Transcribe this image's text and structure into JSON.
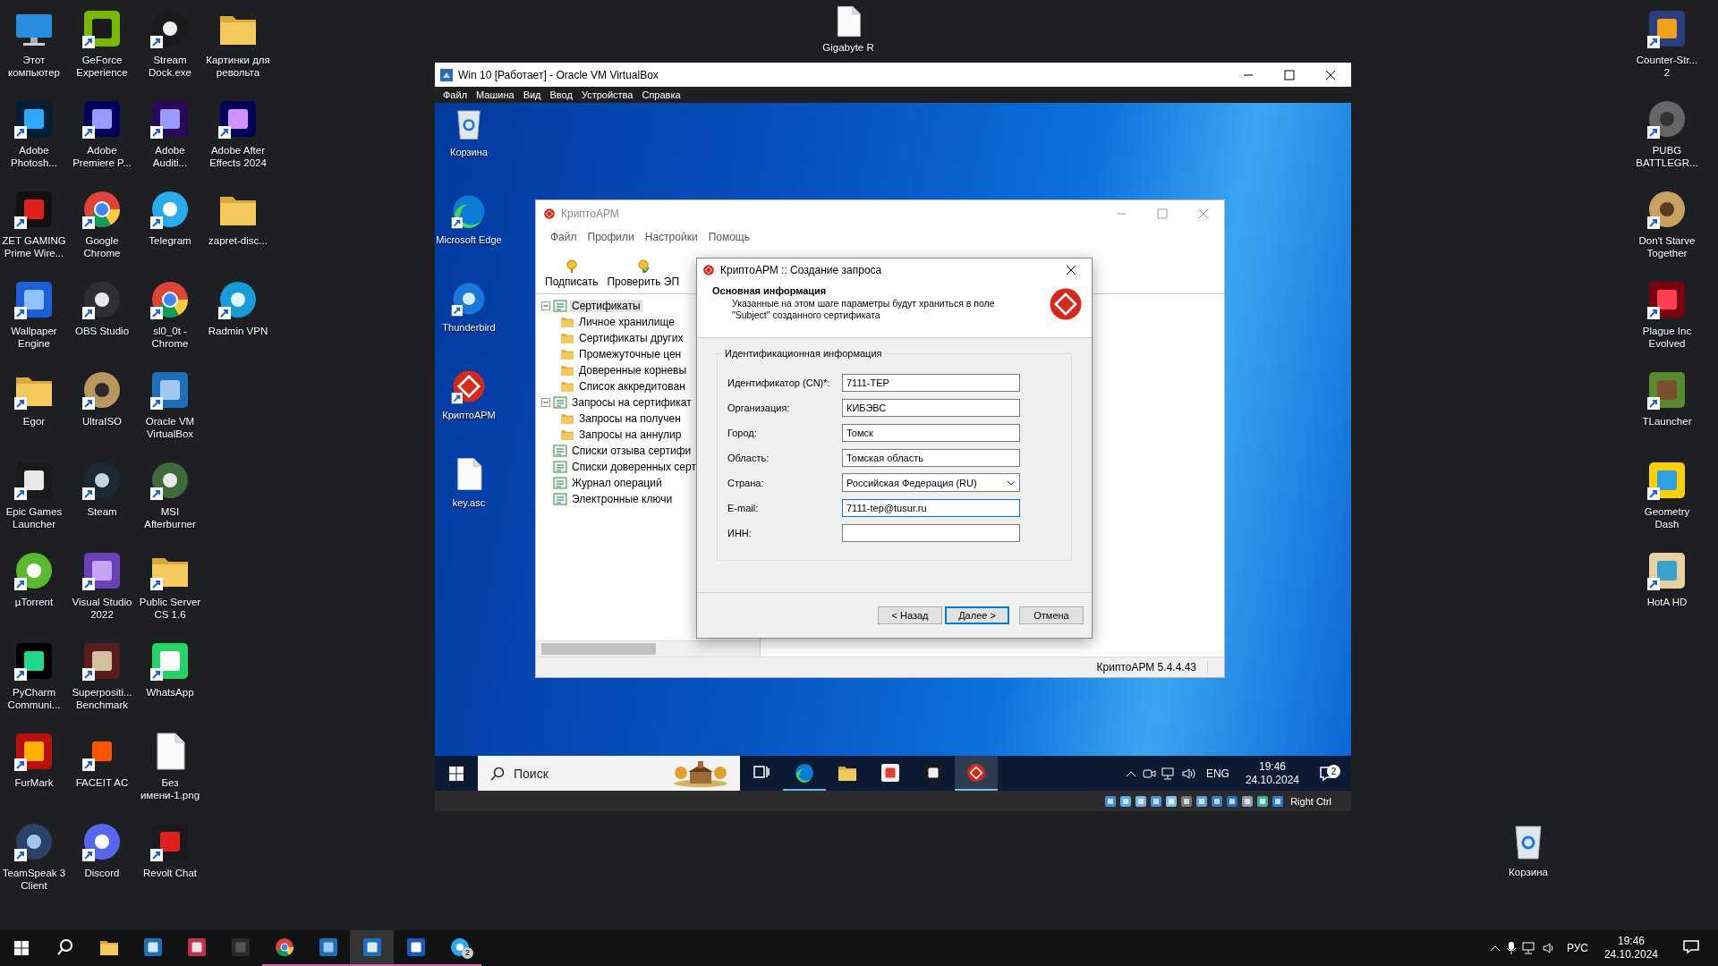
{
  "desktop": {
    "left_icons": [
      {
        "label": "Этот компьютер",
        "shortcut": false
      },
      {
        "label": "Adobe Photosh...",
        "shortcut": true
      },
      {
        "label": "ZET GAMING Prime Wire...",
        "shortcut": true
      },
      {
        "label": "Wallpaper Engine",
        "shortcut": true
      },
      {
        "label": "Egor",
        "shortcut": true
      },
      {
        "label": "Epic Games Launcher",
        "shortcut": true
      },
      {
        "label": "µTorrent",
        "shortcut": true
      },
      {
        "label": "PyCharm Communi...",
        "shortcut": true
      },
      {
        "label": "FurMark",
        "shortcut": true
      },
      {
        "label": "TeamSpeak 3 Client",
        "shortcut": true
      },
      {
        "label": "GeForce Experience",
        "shortcut": true
      },
      {
        "label": "Adobe Premiere P...",
        "shortcut": true
      },
      {
        "label": "Google Chrome",
        "shortcut": true
      },
      {
        "label": "OBS Studio",
        "shortcut": true
      },
      {
        "label": "UltraISO",
        "shortcut": true
      },
      {
        "label": "Steam",
        "shortcut": true
      },
      {
        "label": "Visual Studio 2022",
        "shortcut": true
      },
      {
        "label": "Superpositi... Benchmark",
        "shortcut": true
      },
      {
        "label": "FACEIT AC",
        "shortcut": true
      },
      {
        "label": "Discord",
        "shortcut": true
      },
      {
        "label": "Stream Dock.exe",
        "shortcut": true
      },
      {
        "label": "Adobe Auditi...",
        "shortcut": true
      },
      {
        "label": "Telegram",
        "shortcut": true
      },
      {
        "label": "sl0_0t - Chrome",
        "shortcut": true
      },
      {
        "label": "Oracle VM VirtualBox",
        "shortcut": true
      },
      {
        "label": "MSI Afterburner",
        "shortcut": true
      },
      {
        "label": "Public Server CS 1.6",
        "shortcut": true
      },
      {
        "label": "WhatsApp",
        "shortcut": true
      },
      {
        "label": "Без имени-1.png",
        "shortcut": false
      },
      {
        "label": "Revolt Chat",
        "shortcut": true
      },
      {
        "label": "Картинки для револьта",
        "shortcut": false
      },
      {
        "label": "Adobe After Effects 2024",
        "shortcut": true
      },
      {
        "label": "zapret-disc...",
        "shortcut": false
      },
      {
        "label": "Radmin VPN",
        "shortcut": true
      }
    ],
    "right_icons": [
      {
        "label": "Counter-Str... 2",
        "shortcut": true
      },
      {
        "label": "PUBG BATTLEGR...",
        "shortcut": true
      },
      {
        "label": "Don't Starve Together",
        "shortcut": true
      },
      {
        "label": "Plague Inc Evolved",
        "shortcut": true
      },
      {
        "label": "TLauncher",
        "shortcut": true
      },
      {
        "label": "Geometry Dash",
        "shortcut": true
      },
      {
        "label": "HotA HD",
        "shortcut": true
      }
    ],
    "loose_icons": [
      {
        "label": "Gigabyte R",
        "shortcut": false
      },
      {
        "label": "Корзина",
        "shortcut": false
      }
    ]
  },
  "vm_window": {
    "title": "Win 10 [Работает] - Oracle VM VirtualBox",
    "menu": [
      "Файл",
      "Машина",
      "Вид",
      "Ввод",
      "Устройства",
      "Справка"
    ],
    "guest": {
      "desktop_icons": [
        {
          "label": "Корзина",
          "shortcut": false
        },
        {
          "label": "Microsoft Edge",
          "shortcut": true
        },
        {
          "label": "Thunderbird",
          "shortcut": true
        },
        {
          "label": "КриптоАРМ",
          "shortcut": true
        },
        {
          "label": "key.asc",
          "shortcut": false
        }
      ],
      "app_window": {
        "title": "КриптоАРМ",
        "menu": [
          "Файл",
          "Профили",
          "Настройки",
          "Помощь"
        ],
        "toolbar": [
          "Подписать",
          "Проверить ЭП"
        ],
        "tree": [
          {
            "label": "Сертификаты",
            "selected": true,
            "expanded": true,
            "children": [
              {
                "label": "Личное хранилище",
                "selected": false
              },
              {
                "label": "Сертификаты других",
                "selected": false
              },
              {
                "label": "Промежуточные цен",
                "selected": false
              },
              {
                "label": "Доверенные корневы",
                "selected": false
              },
              {
                "label": "Список аккредитован",
                "selected": false
              }
            ]
          },
          {
            "label": "Запросы на сертификат",
            "selected": false,
            "expanded": true,
            "children": [
              {
                "label": "Запросы на получен",
                "selected": false
              },
              {
                "label": "Запросы на аннулир",
                "selected": false
              }
            ]
          },
          {
            "label": "Списки отзыва сертифи",
            "selected": false
          },
          {
            "label": "Списки доверенных серт",
            "selected": false
          },
          {
            "label": "Журнал операций",
            "selected": false
          },
          {
            "label": "Электронные ключи",
            "selected": false
          }
        ],
        "status": "КриптоАРМ 5.4.4.43"
      },
      "dialog": {
        "title": "КриптоАРМ :: Создание запроса",
        "heading": "Основная информация",
        "description": "Указанные на этом шаге параметры будут храниться в поле \"Subject\" созданного сертификата",
        "group": "Идентификационная информация",
        "fields": [
          {
            "label": "Идентификатор (CN)*:",
            "value": "7111-ТЕР",
            "kind": "text",
            "focused": false
          },
          {
            "label": "Организация:",
            "value": "КИБЭВС",
            "kind": "text",
            "focused": false
          },
          {
            "label": "Город:",
            "value": "Томск",
            "kind": "text",
            "focused": false
          },
          {
            "label": "Область:",
            "value": "Томская область",
            "kind": "text",
            "focused": false
          },
          {
            "label": "Страна:",
            "value": "Российская Федерация (RU)",
            "kind": "select",
            "focused": false
          },
          {
            "label": "E-mail:",
            "value": "7111-tep@tusur.ru",
            "kind": "text",
            "focused": true
          },
          {
            "label": "ИНН:",
            "kind": "text",
            "focused": false
          }
        ],
        "buttons": [
          {
            "label": "< Назад",
            "default": false
          },
          {
            "label": "Далее >",
            "default": true
          },
          {
            "label": "Отмена",
            "default": false
          }
        ]
      },
      "taskbar": {
        "search": {
          "placeholder": "Поиск"
        },
        "apps": [
          {
            "running": false,
            "selected": false
          },
          {
            "running": true,
            "selected": false
          },
          {
            "running": false,
            "selected": false
          },
          {
            "running": false,
            "selected": false
          },
          {
            "running": false,
            "selected": false
          },
          {
            "running": true,
            "selected": true
          }
        ],
        "language": "ENG",
        "time": "19:46",
        "date": "24.10.2024",
        "notifications": "2"
      }
    },
    "status_bar": {
      "host_key": "Right Ctrl"
    }
  },
  "taskbar": {
    "apps": [
      {
        "running": false,
        "selected": false
      },
      {
        "running": false,
        "selected": false
      },
      {
        "running": false,
        "selected": false
      },
      {
        "running": false,
        "selected": false
      },
      {
        "running": true,
        "selected": false
      },
      {
        "running": true,
        "selected": false
      },
      {
        "running": true,
        "selected": true
      },
      {
        "running": true,
        "selected": false
      },
      {
        "running": true,
        "selected": false,
        "badge": "2"
      }
    ],
    "language": "РУС",
    "time": "19:46",
    "date": "24.10.2024"
  }
}
